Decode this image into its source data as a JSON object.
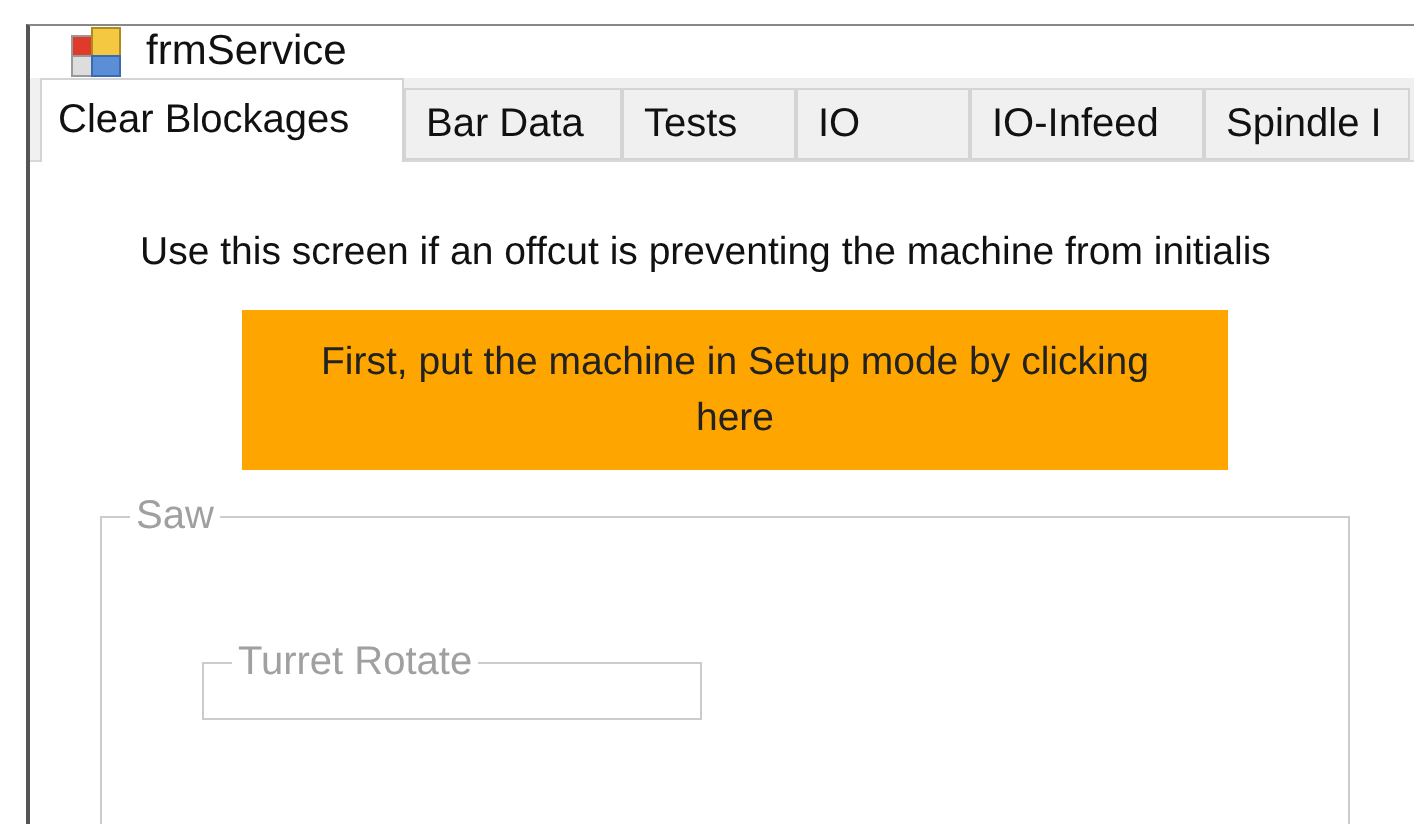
{
  "window": {
    "title": "frmService"
  },
  "tabs": [
    {
      "label": "Clear Blockages",
      "selected": true
    },
    {
      "label": "Bar Data",
      "selected": false
    },
    {
      "label": "Tests",
      "selected": false
    },
    {
      "label": "IO",
      "selected": false
    },
    {
      "label": "IO-Infeed",
      "selected": false
    },
    {
      "label": "Spindle I",
      "selected": false
    }
  ],
  "instruction": "Use this screen if an offcut is preventing the machine from initialis",
  "setup_button": {
    "label": "First, put the machine in Setup mode by clicking here"
  },
  "group": {
    "title": "Saw",
    "disabled": true,
    "subgroup": {
      "title": "Turret Rotate",
      "disabled": true
    }
  }
}
